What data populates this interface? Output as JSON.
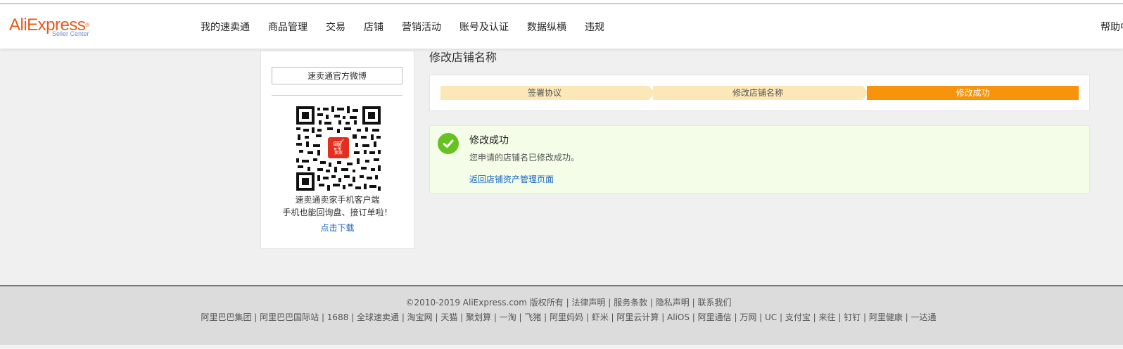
{
  "header": {
    "logo": {
      "brand": "AliExpress",
      "sub": "Seller Center",
      "reg": "®"
    },
    "nav": [
      "我的速卖通",
      "商品管理",
      "交易",
      "店铺",
      "营销活动",
      "账号及认证",
      "数据纵横",
      "违规"
    ],
    "help": "帮助中"
  },
  "sidebar": {
    "weibo_button": "速卖通官方微博",
    "qr_badge": "卖家",
    "app_line1": "速卖通卖家手机客户端",
    "app_line2": "手机也能回询盘、接订单啦！",
    "download_link": "点击下载"
  },
  "main": {
    "title": "修改店铺名称",
    "steps": [
      "签署协议",
      "修改店铺名称",
      "修改成功"
    ],
    "active_step": 3,
    "success": {
      "title": "修改成功",
      "description": "您申请的店铺名已修改成功。",
      "link": "返回店铺资产管理页面"
    }
  },
  "footer": {
    "line1": "©2010-2019 AliExpress.com 版权所有 | 法律声明 | 服务条款 | 隐私声明 | 联系我们",
    "line2": "阿里巴巴集团 | 阿里巴巴国际站 | 1688 | 全球速卖通 | 淘宝网 | 天猫 | 聚划算 | 一淘 | 飞猪 | 阿里妈妈 | 虾米 | 阿里云计算 | AliOS | 阿里通信 | 万网 | UC | 支付宝 | 来往 | 钉钉 | 阿里健康 | 一达通"
  },
  "colors": {
    "brand_orange": "#e8591a",
    "step_active": "#f7940c",
    "step_inactive": "#fce8b6",
    "success_green": "#64c31f",
    "link_blue": "#1a66c4"
  }
}
